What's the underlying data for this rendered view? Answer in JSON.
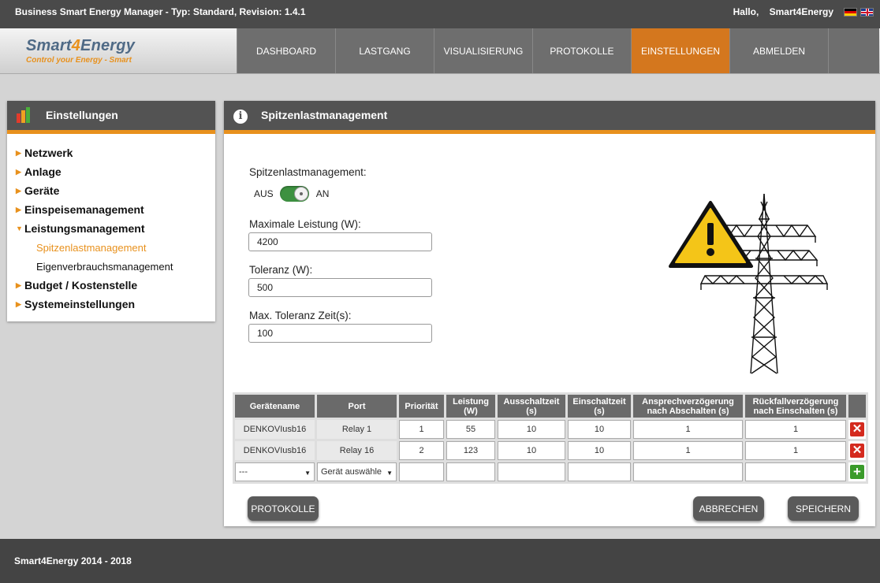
{
  "topbar": {
    "title": "Business Smart Energy Manager - Typ: Standard, Revision: 1.4.1",
    "greeting": "Hallo,",
    "user": "Smart4Energy",
    "languages": [
      "de-flag-icon",
      "uk-flag-icon"
    ]
  },
  "logo": {
    "part1": "Smart",
    "part2": "4",
    "part3": "Energy",
    "tagline": "Control your Energy - Smart"
  },
  "nav": {
    "items": [
      "DASHBOARD",
      "LASTGANG",
      "VISUALISIERUNG",
      "PROTOKOLLE",
      "EINSTELLUNGEN",
      "ABMELDEN"
    ],
    "active": "EINSTELLUNGEN"
  },
  "sidebar": {
    "title": "Einstellungen",
    "icon": "bar-chart-icon",
    "items": [
      "Netzwerk",
      "Anlage",
      "Geräte",
      "Einspeisemanagement",
      "Leistungsmanagement",
      "Budget / Kostenstelle",
      "Systemeinstellungen"
    ],
    "subitems": [
      "Spitzenlastmanagement",
      "Eigenverbrauchsmanagement"
    ],
    "active_subitem": "Spitzenlastmanagement"
  },
  "content": {
    "title": "Spitzenlastmanagement",
    "icon": "info-icon",
    "toggle_label": "Spitzenlastmanagement:",
    "toggle_off": "AUS",
    "toggle_on": "AN",
    "toggle_state": "on",
    "fields": {
      "max_power_label": "Maximale Leistung (W):",
      "max_power_value": "4200",
      "tolerance_label": "Toleranz (W):",
      "tolerance_value": "500",
      "tolerance_time_label": "Max. Toleranz Zeit(s):",
      "tolerance_time_value": "100"
    },
    "illustration": [
      "warning-triangle-icon",
      "power-pylon-icon"
    ]
  },
  "table": {
    "headers": [
      [
        "Gerätename"
      ],
      [
        "Port"
      ],
      [
        "Priorität"
      ],
      [
        "Leistung",
        "(W)"
      ],
      [
        "Ausschaltzeit",
        "(s)"
      ],
      [
        "Einschaltzeit",
        "(s)"
      ],
      [
        "Ansprechverzögerung",
        "nach Abschalten (s)"
      ],
      [
        "Rückfallverzögerung",
        "nach Einschalten (s)"
      ]
    ],
    "rows": [
      {
        "device": "DENKOVIusb16",
        "port": "Relay 1",
        "priority": "1",
        "power": "55",
        "off_time": "10",
        "on_time": "10",
        "response_delay": "1",
        "fallback_delay": "1"
      },
      {
        "device": "DENKOVIusb16",
        "port": "Relay 16",
        "priority": "2",
        "power": "123",
        "off_time": "10",
        "on_time": "10",
        "response_delay": "1",
        "fallback_delay": "1"
      }
    ],
    "new_row": {
      "device_select": "---",
      "port_select": "Gerät auswähle"
    }
  },
  "buttons": {
    "protocols": "PROTOKOLLE",
    "cancel": "ABBRECHEN",
    "save": "SPEICHERN"
  },
  "footer": {
    "text": "Smart4Energy 2014 - 2018"
  },
  "colors": {
    "accent": "#e8911d",
    "nav_active": "#d4771e",
    "toggle_on": "#3d9140",
    "delete": "#d42a1e",
    "add": "#3a9b2a"
  }
}
